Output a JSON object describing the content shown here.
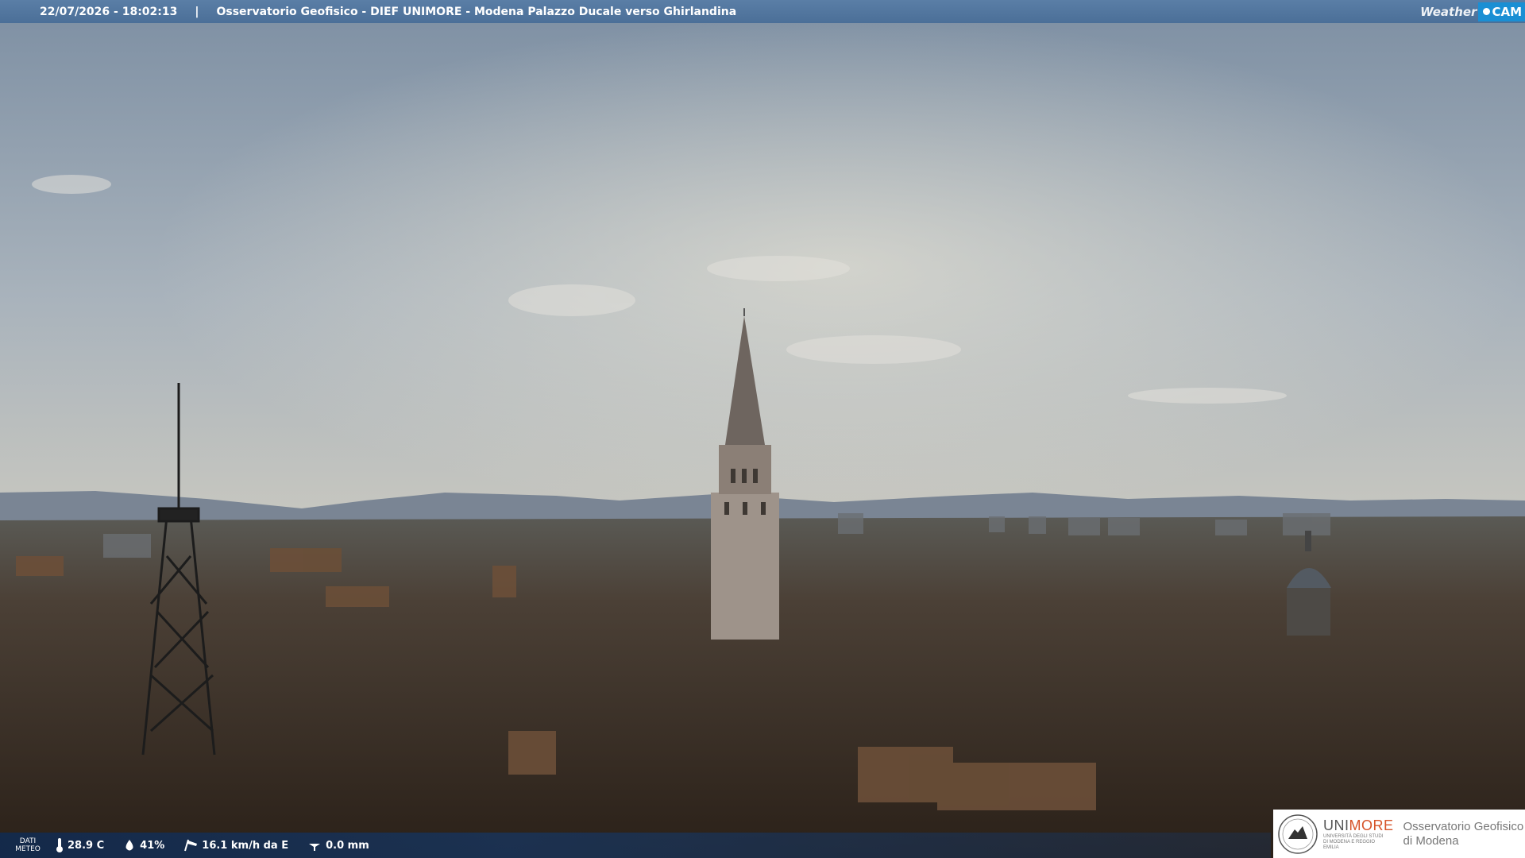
{
  "header": {
    "timestamp": "22/07/2026 - 18:02:13",
    "separator": "|",
    "station_title": "Osservatorio Geofisico - DIEF UNIMORE - Modena Palazzo Ducale verso Ghirlandina",
    "brand_weather": "Weather",
    "brand_cam": "CAM"
  },
  "weather": {
    "label_line1": "DATI",
    "label_line2": "METEO",
    "temperature": "28.9 C",
    "humidity": "41%",
    "wind": "16.1 km/h da E",
    "rain": "0.0 mm",
    "icons": [
      "thermometer-icon",
      "humidity-drop-icon",
      "wind-sock-icon",
      "rain-gauge-icon"
    ]
  },
  "logo": {
    "uni": "UNI",
    "more": "MORE",
    "university_line": "UNIVERSITÀ DEGLI STUDI DI MODENA E REGGIO EMILIA",
    "observatory_line1": "Osservatorio Geofisico",
    "observatory_line2": "di Modena"
  },
  "colors": {
    "top_bar": "#4b6f98",
    "accent_more": "#d6542a",
    "brand_cam": "#1a8fd4"
  }
}
